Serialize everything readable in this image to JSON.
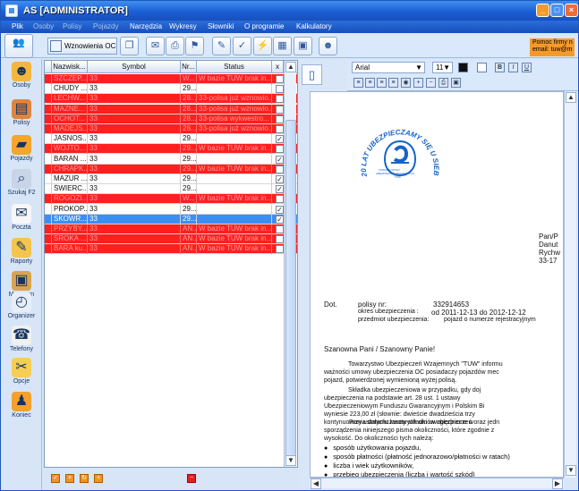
{
  "window": {
    "title": "AS [ADMINISTRATOR]",
    "controls": [
      "_",
      "□",
      "×"
    ]
  },
  "menu": [
    {
      "label": "Plik",
      "disabled": false
    },
    {
      "label": "Osoby",
      "disabled": true
    },
    {
      "label": "Polisy",
      "disabled": true
    },
    {
      "label": "Pojazdy",
      "disabled": true
    },
    {
      "label": "Narzędzia",
      "disabled": false
    },
    {
      "label": "Wykresy",
      "disabled": false
    },
    {
      "label": "Słowniki",
      "disabled": false
    },
    {
      "label": "O programie",
      "disabled": false
    },
    {
      "label": "Kalkulatory",
      "disabled": false
    }
  ],
  "toolbar": {
    "button_label": "Wznowienia OC",
    "notice_lines": [
      "Pomoc firmy n",
      "email: tuw@m"
    ]
  },
  "sidebar": {
    "items": [
      {
        "label": "Osoby",
        "icon": "people-icon"
      },
      {
        "label": "Polisy",
        "icon": "policy-icon"
      },
      {
        "label": "Pojazdy",
        "icon": "truck-icon"
      },
      {
        "label": "Szukaj F2",
        "icon": "search-icon"
      },
      {
        "label": "Poczta",
        "icon": "mail-icon"
      },
      {
        "label": "Raporty",
        "icon": "report-icon"
      },
      {
        "label": "Magazyn",
        "icon": "storage-icon"
      },
      {
        "label": "Organizer",
        "icon": "clock-icon"
      },
      {
        "label": "Telefony",
        "icon": "phone-icon"
      },
      {
        "label": "Opcje",
        "icon": "options-icon"
      },
      {
        "label": "Koniec",
        "icon": "exit-icon"
      }
    ]
  },
  "table": {
    "headers": [
      "Nazwisk...",
      "Symbol",
      "Nr...",
      "Status",
      "x"
    ],
    "rows": [
      {
        "name": "SZCZEP...",
        "symbol": "33",
        "nr": "W...",
        "status": "W bazie TUW brak in...",
        "checked": false,
        "color": "red"
      },
      {
        "name": "CHUDY ...",
        "symbol": "33",
        "nr": "29...",
        "status": "",
        "checked": false,
        "color": "white"
      },
      {
        "name": "LECHW...",
        "symbol": "33",
        "nr": "28...",
        "status": "33-polisa już wznowio...",
        "checked": false,
        "color": "red"
      },
      {
        "name": "MAZNE...",
        "symbol": "33",
        "nr": "28...",
        "status": "33-polisa już wznowio...",
        "checked": false,
        "color": "red"
      },
      {
        "name": "OCHOT...",
        "symbol": "33",
        "nr": "28...",
        "status": "33-polisa wykwestro...",
        "checked": false,
        "color": "red"
      },
      {
        "name": "MADEJS...",
        "symbol": "33",
        "nr": "28...",
        "status": "33-polisa już wznowio...",
        "checked": false,
        "color": "red"
      },
      {
        "name": "JASNOS...",
        "symbol": "33",
        "nr": "29...",
        "status": "",
        "checked": true,
        "color": "white"
      },
      {
        "name": "WOJTO...",
        "symbol": "33",
        "nr": "29...",
        "status": "W bazie TUW brak in...",
        "checked": false,
        "color": "red"
      },
      {
        "name": "BARAN ...",
        "symbol": "33",
        "nr": "29...",
        "status": "",
        "checked": true,
        "color": "white"
      },
      {
        "name": "CHRAPK...",
        "symbol": "33",
        "nr": "29...",
        "status": "W bazie TUW brak in...",
        "checked": false,
        "color": "red"
      },
      {
        "name": "MAZUR ...",
        "symbol": "33",
        "nr": "29...",
        "status": "",
        "checked": true,
        "color": "white"
      },
      {
        "name": "ŚWIERC...",
        "symbol": "33",
        "nr": "29...",
        "status": "",
        "checked": true,
        "color": "white"
      },
      {
        "name": "ROGOZI...",
        "symbol": "33",
        "nr": "W...",
        "status": "W bazie TUW brak in...",
        "checked": false,
        "color": "red"
      },
      {
        "name": "PROKOP...",
        "symbol": "33",
        "nr": "29...",
        "status": "",
        "checked": true,
        "color": "white"
      },
      {
        "name": "SKOWR...",
        "symbol": "33",
        "nr": "29...",
        "status": "",
        "checked": true,
        "color": "blue"
      },
      {
        "name": "PRZYBY...",
        "symbol": "33",
        "nr": "AN...",
        "status": "W bazie TUW brak in...",
        "checked": false,
        "color": "red"
      },
      {
        "name": "SROKA ...",
        "symbol": "33",
        "nr": "AN...",
        "status": "W bazie TUW brak in...",
        "checked": false,
        "color": "red"
      },
      {
        "name": "BARA ku...",
        "symbol": "33",
        "nr": "AN...",
        "status": "W bazie TUW brak in...",
        "checked": false,
        "color": "red"
      }
    ]
  },
  "editor": {
    "font": "Arial",
    "size": "11",
    "buttons": [
      "B",
      "I",
      "U"
    ]
  },
  "document": {
    "seal_text": "20 LAT UBEZPIECZAMY SIĘ U SIEBIE JUŻ",
    "seal_center_lines": [
      "TOWARZYSTWO",
      "UBEZPIECZEŃ WZAJEMNYCH",
      "TUW"
    ],
    "recipient": [
      "Pan/P",
      "Danut",
      "Rychw",
      "33-17"
    ],
    "dot_label": "Dot.",
    "policy_label": "polisy nr:",
    "policy_number": "332914653",
    "insurance_period_label": "okres ubezpieczenia :",
    "insurance_period": "od 2011-12-13 do 2012-12-12",
    "subject_label": "przedmiot ubezpieczenia:",
    "subject": "pojazd o numerze rejestracyjnym",
    "greeting": "Szanowna Pani / Szanowny Panie!",
    "para1": [
      "Towarzystwo Ubezpieczeń Wzajemnych \"TUW\" informu",
      "ważności umowy ubezpieczenia OC posiadaczy pojazdów mec",
      "pojazd, potwierdzonej wymienioną wyżej polisą."
    ],
    "para2": [
      "Składka ubezpieczeniowa w przypadku, gdy doj",
      "ubezpieczenia na podstawie art. 28 ust. 1 ustawy",
      "Ubezpieczeniowym Funduszu Gwarancyjnym i Polskim Bi",
      "wyniesie 223,00 zł (słownie: dwieście dwadzieścia trzy",
      "kontynuowania dotychczasowych umów ubezpieczeń oraz jedn"
    ],
    "para3": [
      "Przy ustalaniu kwoty składki uwzględnione w",
      "sporządzenia niniejszego pisma okoliczności, które zgodnie z",
      "wysokość. Do okoliczności tych należą:"
    ],
    "bullets": [
      "sposób użytkowania pojazdu,",
      "sposób płatności (płatność jednorazowo/płatności w ratach)",
      "liczba i wiek użytkowników,",
      "przebieg ubezpieczenia (liczba i wartość szkód)"
    ]
  }
}
